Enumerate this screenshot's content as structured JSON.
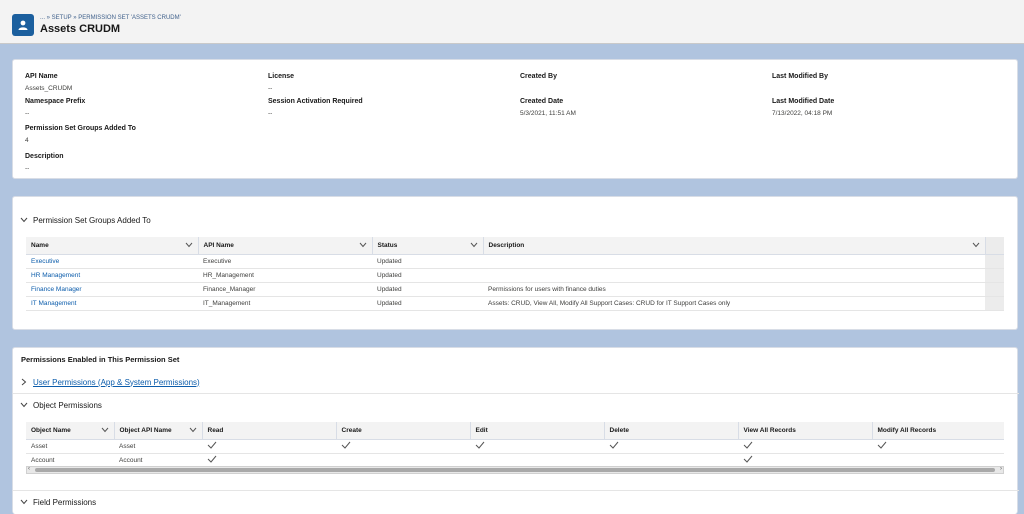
{
  "header": {
    "breadcrumb": "... » SETUP » PERMISSION SET 'ASSETS CRUDM'",
    "title": "Assets CRUDM",
    "icon": "user-icon"
  },
  "details": {
    "api_name_label": "API Name",
    "api_name_value": "Assets_CRUDM",
    "license_label": "License",
    "license_value": "--",
    "created_by_label": "Created By",
    "last_modified_by_label": "Last Modified By",
    "namespace_label": "Namespace Prefix",
    "namespace_value": "--",
    "session_label": "Session Activation Required",
    "session_value": "--",
    "created_date_label": "Created Date",
    "created_date_value": "5/3/2021, 11:51 AM",
    "last_modified_date_label": "Last Modified Date",
    "last_modified_date_value": "7/13/2022, 04:18 PM",
    "psg_label": "Permission Set Groups Added To",
    "psg_value": "4",
    "description_label": "Description",
    "description_value": "--"
  },
  "groups": {
    "section_title": "Permission Set Groups Added To",
    "columns": [
      "Name",
      "API Name",
      "Status",
      "Description"
    ],
    "rows": [
      {
        "name": "Executive",
        "api": "Executive",
        "status": "Updated",
        "desc": ""
      },
      {
        "name": "HR Management",
        "api": "HR_Management",
        "status": "Updated",
        "desc": ""
      },
      {
        "name": "Finance Manager",
        "api": "Finance_Manager",
        "status": "Updated",
        "desc": "Permissions for users with finance duties"
      },
      {
        "name": "IT Management",
        "api": "IT_Management",
        "status": "Updated",
        "desc": "Assets: CRUD, View All, Modify All Support Cases: CRUD for IT Support Cases only"
      }
    ]
  },
  "permissions": {
    "title": "Permissions Enabled in This Permission Set",
    "user_permissions": "User Permissions (App & System Permissions)",
    "object_permissions": "Object Permissions",
    "field_permissions": "Field Permissions",
    "columns": [
      "Object Name",
      "Object API Name",
      "Read",
      "Create",
      "Edit",
      "Delete",
      "View All Records",
      "Modify All Records"
    ],
    "rows": [
      {
        "object": "Asset",
        "api": "Asset",
        "read": true,
        "create": true,
        "edit": true,
        "delete": true,
        "view_all": true,
        "modify_all": true
      },
      {
        "object": "Account",
        "api": "Account",
        "read": true,
        "create": false,
        "edit": false,
        "delete": false,
        "view_all": true,
        "modify_all": false
      }
    ]
  },
  "colors": {
    "link": "#0b5cab",
    "background": "#b0c4df",
    "brand_icon": "#1b5f9e"
  }
}
